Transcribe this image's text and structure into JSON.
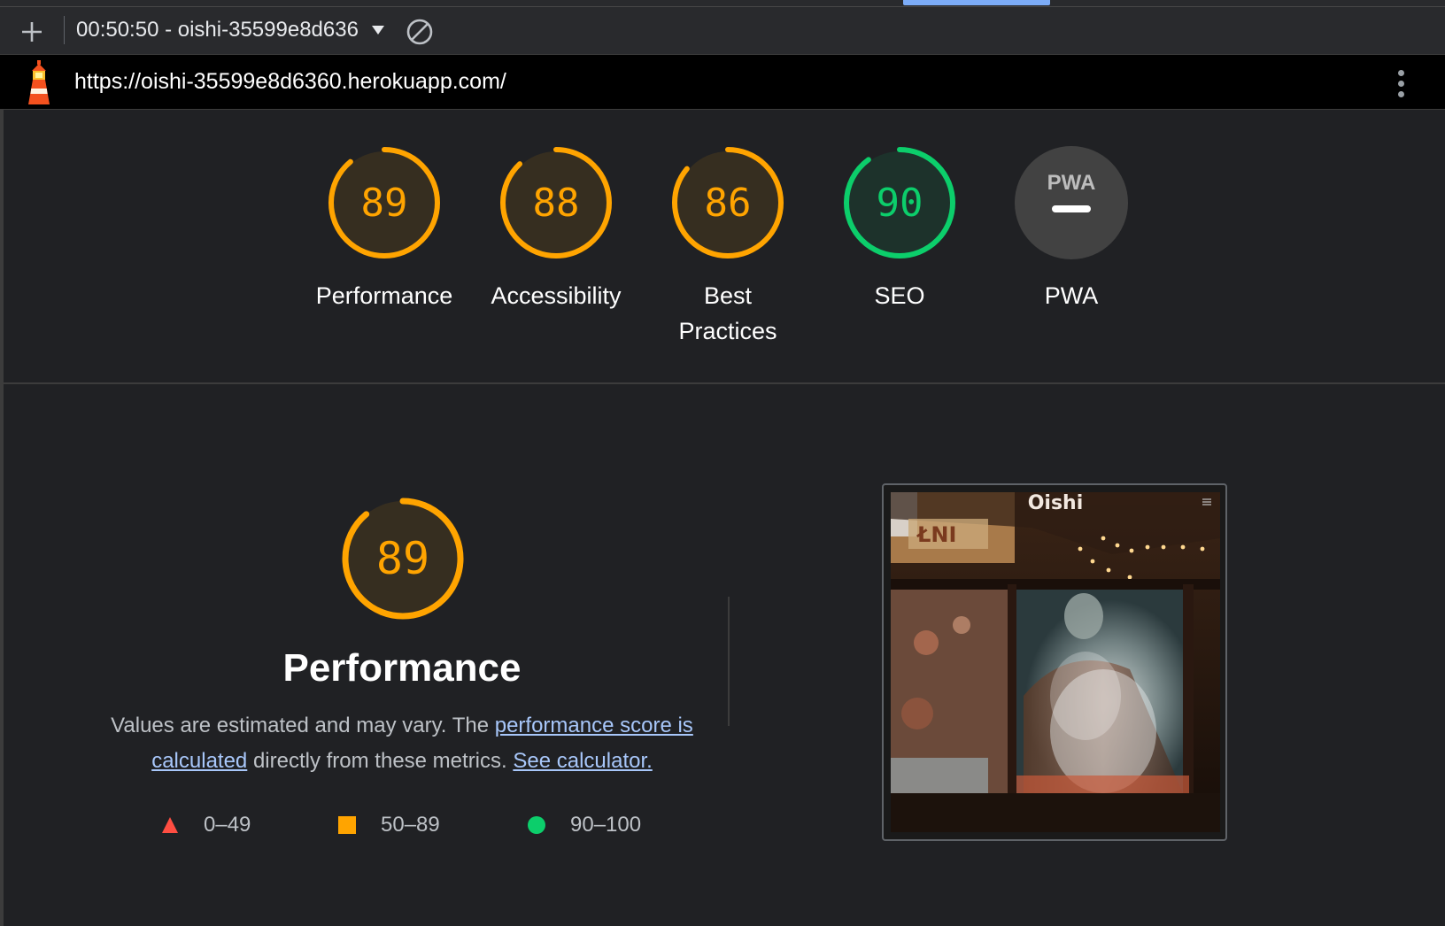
{
  "toolbar": {
    "report_label": "00:50:50 - oishi-35599e8d636",
    "new_report_icon": "plus-icon",
    "clear_icon": "block-icon"
  },
  "urlbar": {
    "logo_icon": "lighthouse-icon",
    "url": "https://oishi-35599e8d6360.herokuapp.com/",
    "menu_icon": "kebab-menu-icon"
  },
  "colors": {
    "average": "#ffa400",
    "pass": "#0cce6b",
    "fail": "#ff4e42",
    "link": "#a8c7fa"
  },
  "scores": [
    {
      "label": "Performance",
      "value": 89,
      "status": "average"
    },
    {
      "label": "Accessibility",
      "value": 88,
      "status": "average"
    },
    {
      "label": "Best Practices",
      "value": 86,
      "status": "average"
    },
    {
      "label": "SEO",
      "value": 90,
      "status": "pass"
    },
    {
      "label": "PWA",
      "value": null,
      "badge": "PWA",
      "status": "na"
    }
  ],
  "performance": {
    "score": "89",
    "title": "Performance",
    "desc_prefix": "Values are estimated and may vary. The ",
    "desc_link": "performance score is calculated",
    "desc_middle": " directly from these metrics. ",
    "calc_link": "See calculator.",
    "legend": [
      {
        "range": "0–49",
        "shape": "triangle"
      },
      {
        "range": "50–89",
        "shape": "square"
      },
      {
        "range": "90–100",
        "shape": "circle"
      }
    ]
  },
  "screenshot": {
    "brand": "Oishi",
    "menu_icon": "hamburger-icon"
  }
}
